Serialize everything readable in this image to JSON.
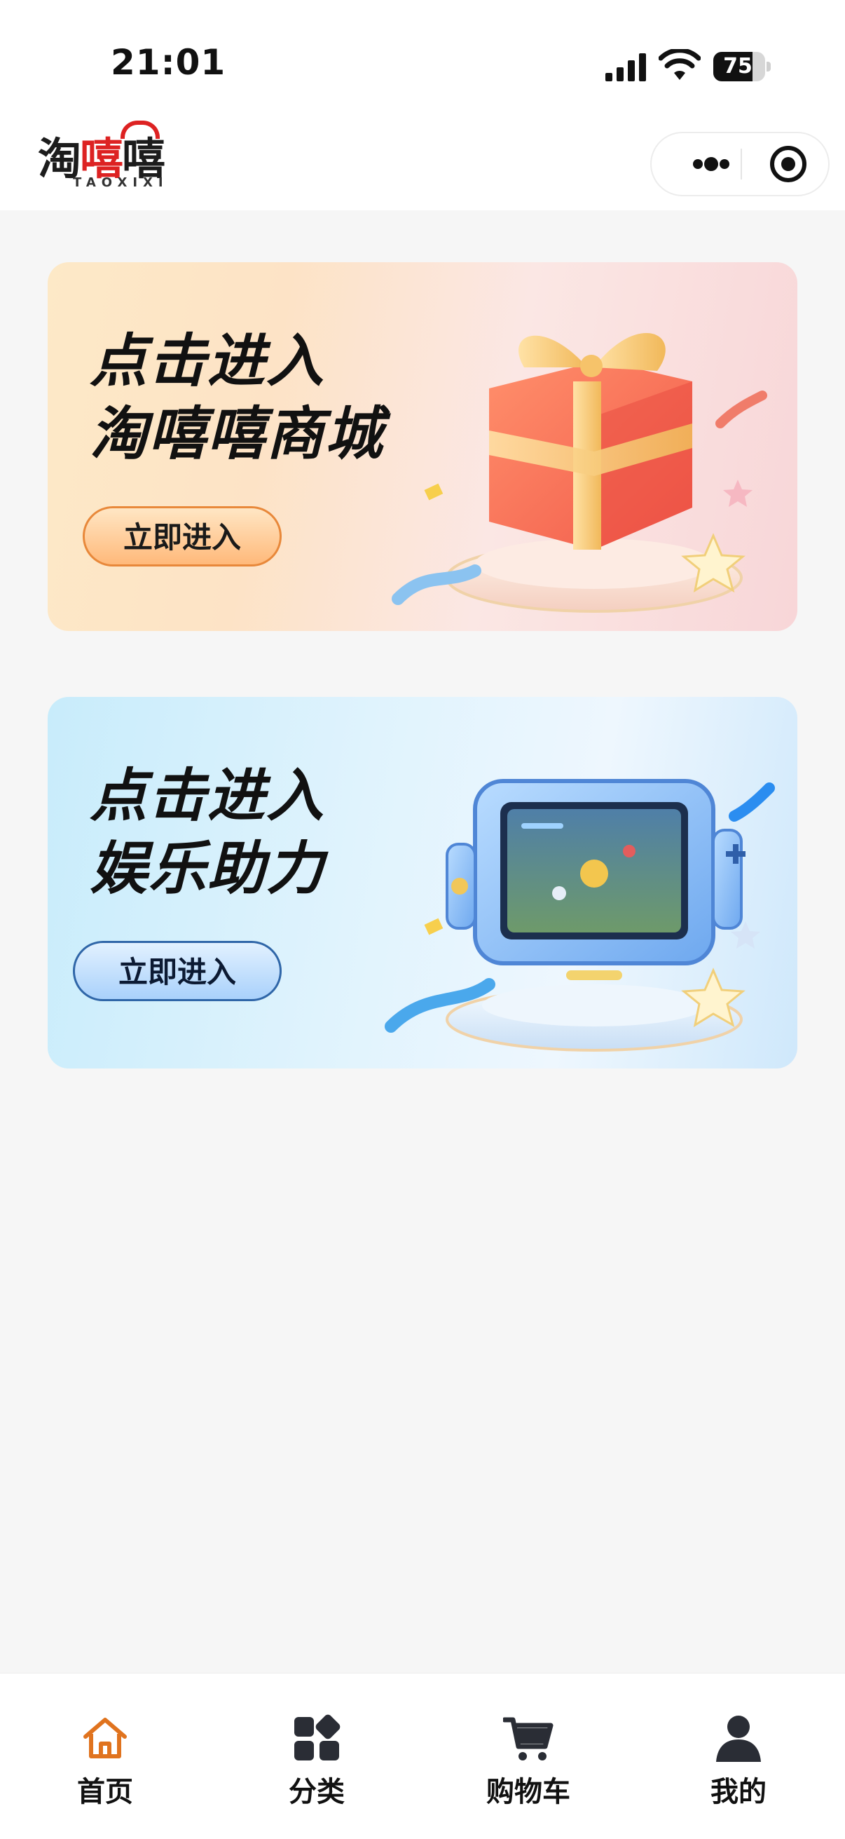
{
  "status_bar": {
    "time": "21:01",
    "battery": "75",
    "battery_level": 0.75
  },
  "header": {
    "logo_cn": [
      "淘",
      "嘻",
      "嘻"
    ],
    "logo_en": "TAOXIXI"
  },
  "banners": [
    {
      "title_line1": "点击进入",
      "title_line2": "淘嘻嘻商城",
      "cta": "立即进入",
      "art": "gift-box"
    },
    {
      "title_line1": "点击进入",
      "title_line2": "娱乐助力",
      "cta": "立即进入",
      "art": "game-console"
    }
  ],
  "tabbar": {
    "active_color": "#e0731e",
    "items": [
      {
        "label": "首页",
        "icon": "home-icon",
        "active": true
      },
      {
        "label": "分类",
        "icon": "category-icon",
        "active": false
      },
      {
        "label": "购物车",
        "icon": "cart-icon",
        "active": false
      },
      {
        "label": "我的",
        "icon": "user-icon",
        "active": false
      }
    ]
  }
}
